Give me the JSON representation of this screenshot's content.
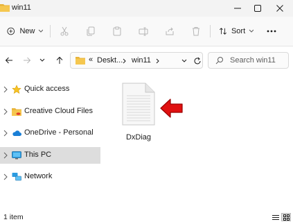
{
  "window": {
    "title": "win11"
  },
  "toolbar": {
    "new_label": "New",
    "sort_label": "Sort"
  },
  "address": {
    "overflow": "«",
    "crumbs": [
      "Deskt...",
      "win11"
    ]
  },
  "search": {
    "placeholder": "Search win11"
  },
  "sidebar": {
    "items": [
      {
        "label": "Quick access",
        "icon": "star-icon"
      },
      {
        "label": "Creative Cloud Files",
        "icon": "creative-cloud-folder-icon"
      },
      {
        "label": "OneDrive - Personal",
        "icon": "cloud-icon"
      },
      {
        "label": "This PC",
        "icon": "monitor-icon",
        "selected": true
      },
      {
        "label": "Network",
        "icon": "network-icon"
      }
    ]
  },
  "files": [
    {
      "name": "DxDiag",
      "icon": "text-document-icon"
    }
  ],
  "status": {
    "item_count": "1 item"
  },
  "colors": {
    "accent": "#0067c0",
    "folder": "#f2c14e",
    "arrow_red": "#e01010",
    "selection": "#dddddd"
  }
}
